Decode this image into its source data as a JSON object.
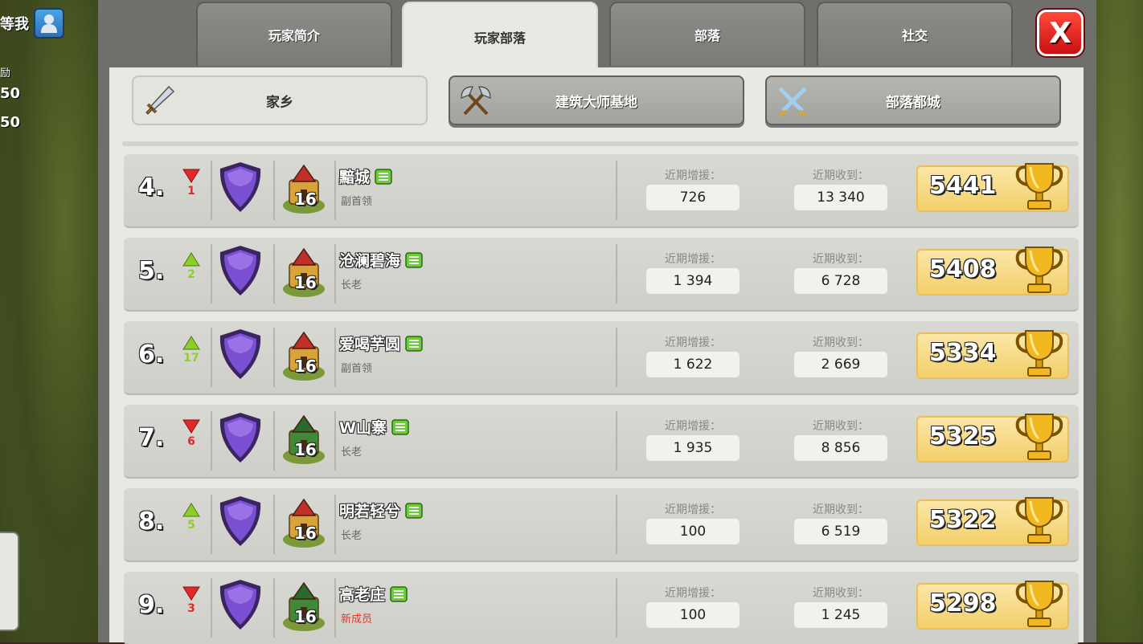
{
  "hud": {
    "wait_label": "等我",
    "reward_label": "励",
    "num_1": "50",
    "num_2": "50"
  },
  "tabs": [
    {
      "label": "玩家简介",
      "active": false
    },
    {
      "label": "玩家部落",
      "active": true
    },
    {
      "label": "部落",
      "active": false
    },
    {
      "label": "社交",
      "active": false
    }
  ],
  "close_label": "X",
  "subtabs": [
    {
      "label": "家乡",
      "icon": "sword-icon",
      "active": true
    },
    {
      "label": "建筑大师基地",
      "icon": "crossed-axes-icon",
      "active": false
    },
    {
      "label": "部落都城",
      "icon": "crossed-swords-icon",
      "active": false
    }
  ],
  "stat_labels": {
    "donated": "近期增援：",
    "received": "近期收到："
  },
  "members": [
    {
      "rank": "4.",
      "direction": "down",
      "change": "1",
      "th_level": "16",
      "th_style": "gold",
      "name": "黯城",
      "role": "副首领",
      "role_new": false,
      "donated": "726",
      "received": "13 340",
      "trophies": "5441"
    },
    {
      "rank": "5.",
      "direction": "up",
      "change": "2",
      "th_level": "16",
      "th_style": "gold",
      "name": "沧澜碧海",
      "role": "长老",
      "role_new": false,
      "donated": "1 394",
      "received": "6 728",
      "trophies": "5408"
    },
    {
      "rank": "6.",
      "direction": "up",
      "change": "17",
      "th_level": "16",
      "th_style": "gold",
      "name": "爱喝芋圆",
      "role": "副首领",
      "role_new": false,
      "donated": "1 622",
      "received": "2 669",
      "trophies": "5334"
    },
    {
      "rank": "7.",
      "direction": "down",
      "change": "6",
      "th_level": "16",
      "th_style": "green",
      "name": "W山寨",
      "role": "长老",
      "role_new": false,
      "donated": "1 935",
      "received": "8 856",
      "trophies": "5325"
    },
    {
      "rank": "8.",
      "direction": "up",
      "change": "5",
      "th_level": "16",
      "th_style": "gold",
      "name": "明若轻兮",
      "role": "长老",
      "role_new": false,
      "donated": "100",
      "received": "6 519",
      "trophies": "5322"
    },
    {
      "rank": "9.",
      "direction": "down",
      "change": "3",
      "th_level": "16",
      "th_style": "green",
      "name": "高老庄",
      "role": "新成员",
      "role_new": true,
      "donated": "100",
      "received": "1 245",
      "trophies": "5298"
    }
  ],
  "colors": {
    "up": "#8ccf2a",
    "down": "#e02a2a",
    "league": "#7a4fd1",
    "trophy": "#f2b81f"
  }
}
